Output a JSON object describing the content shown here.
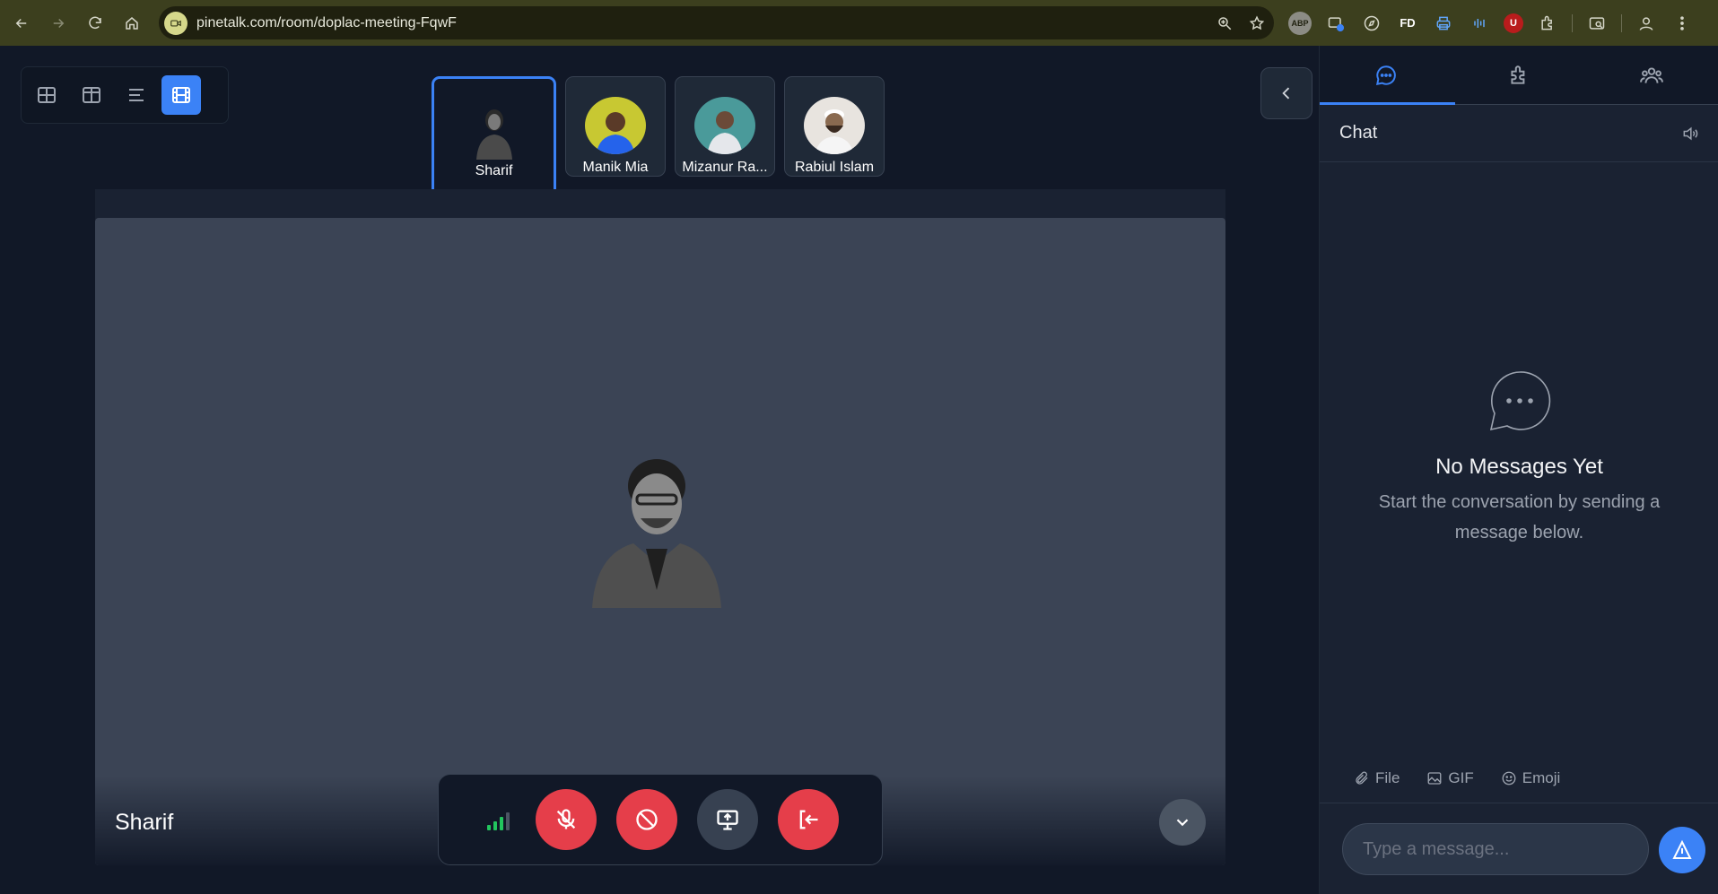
{
  "browser": {
    "url": "pinetalk.com/room/doplac-meeting-FqwF",
    "extensions": [
      "ABP",
      "FD",
      "U"
    ]
  },
  "view_modes": [
    "grid-icon",
    "split-icon",
    "list-icon",
    "spotlight-icon"
  ],
  "participants": [
    {
      "name": "Sharif",
      "active": true
    },
    {
      "name": "Manik Mia",
      "active": false
    },
    {
      "name": "Mizanur Ra...",
      "active": false
    },
    {
      "name": "Rabiul Islam",
      "active": false
    }
  ],
  "stage": {
    "speaker_name": "Sharif"
  },
  "controls": {
    "signal_level": 3,
    "buttons": [
      "mic-off",
      "camera-blocked",
      "screen-share",
      "leave"
    ]
  },
  "side_panel": {
    "tabs": [
      "chat",
      "extensions",
      "people"
    ],
    "chat_title": "Chat",
    "empty_title": "No Messages Yet",
    "empty_subtitle": "Start the conversation by sending a message below.",
    "attach": {
      "file": "File",
      "gif": "GIF",
      "emoji": "Emoji"
    },
    "input_placeholder": "Type a message..."
  },
  "colors": {
    "accent": "#3b82f6",
    "danger": "#e53e4a",
    "signal": "#22c55e",
    "background": "#111827"
  }
}
